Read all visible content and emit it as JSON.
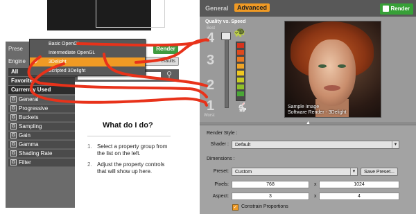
{
  "left": {
    "preset_header": "Prese",
    "engine_label": "Engine",
    "render_button": "Render",
    "defaults_button": "efaults",
    "categories": [
      {
        "label": "All"
      },
      {
        "label": "Favorites"
      },
      {
        "label": "Currently Used"
      }
    ],
    "properties": [
      {
        "label": "General"
      },
      {
        "label": "Progressive"
      },
      {
        "label": "Buckets"
      },
      {
        "label": "Sampling"
      },
      {
        "label": "Gain"
      },
      {
        "label": "Gamma"
      },
      {
        "label": "Shading Rate"
      },
      {
        "label": "Filter"
      }
    ],
    "menu": [
      {
        "label": "Basic OpenGL",
        "selected": false
      },
      {
        "label": "Intermediate OpenGL",
        "selected": false
      },
      {
        "label": "3Delight",
        "selected": true
      },
      {
        "label": "Scripted 3Delight",
        "selected": false
      }
    ],
    "help": {
      "title": "What do I do?",
      "step1_num": "1.",
      "step1": "Select a property group from the list on the left.",
      "step2_num": "2.",
      "step2": "Adjust the property controls that will show up here."
    }
  },
  "right": {
    "tab_general": "General",
    "tab_advanced": "Advanced",
    "render_button": "Render",
    "quality_title": "Quality vs. Speed",
    "best_label": "Best",
    "worst_label": "Worst",
    "numbers": [
      "4",
      "3",
      "2",
      "1"
    ],
    "preview_caption_1": "Sample Image",
    "preview_caption_2": "Software Render - 3Delight",
    "render_style_header": "Render Style :",
    "shader_label": "Shader :",
    "shader_value": "Default",
    "dimensions_header": "Dimensions :",
    "preset_label": "Preset:",
    "preset_value": "Custom",
    "save_preset_button": "Save Preset...",
    "pixels_label": "Pixels:",
    "pixels_w": "768",
    "pixels_h": "1024",
    "times": "x",
    "aspect_label": "Aspect:",
    "aspect_w": "3",
    "aspect_h": "4",
    "constrain_label": "Constrain Proportions"
  },
  "colors": {
    "accent_orange": "#f09a24",
    "render_green": "#37a037",
    "annotation_red": "#e8321a"
  }
}
